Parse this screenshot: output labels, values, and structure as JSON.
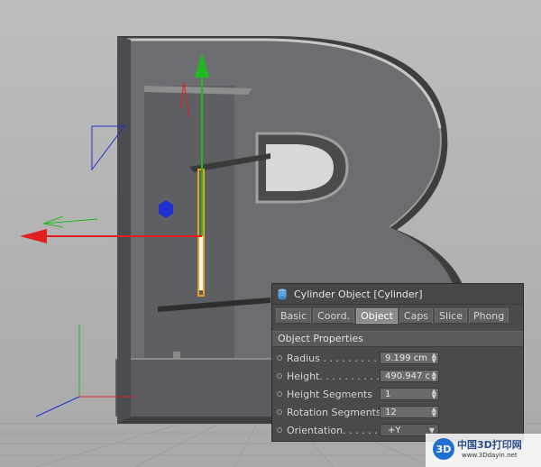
{
  "panel": {
    "title": "Cylinder Object [Cylinder]",
    "tabs": [
      {
        "label": "Basic",
        "active": false
      },
      {
        "label": "Coord.",
        "active": false
      },
      {
        "label": "Object",
        "active": true
      },
      {
        "label": "Caps",
        "active": false
      },
      {
        "label": "Slice",
        "active": false
      },
      {
        "label": "Phong",
        "active": false
      }
    ],
    "section_title": "Object Properties",
    "fields": [
      {
        "label": "Radius . . . . . . . . . . . . .",
        "value": "9.199 cm"
      },
      {
        "label": "Height. . . . . . . . . . . . .",
        "value": "490.947 c"
      },
      {
        "label": "Height Segments",
        "value": "1"
      },
      {
        "label": "Rotation Segments",
        "value": "12"
      },
      {
        "label": "Orientation. . . . . . . . .",
        "value": "+Y"
      }
    ]
  },
  "watermark": {
    "logo_text": "3D",
    "text": "中国3D打印网",
    "url": "www.3Ddayin.net"
  },
  "colors": {
    "axis_y": "#22b822",
    "axis_x": "#e02020",
    "axis_z": "#2030d0",
    "panel_bg": "#4a4a4a",
    "active_tab": "#8b8b8b"
  }
}
